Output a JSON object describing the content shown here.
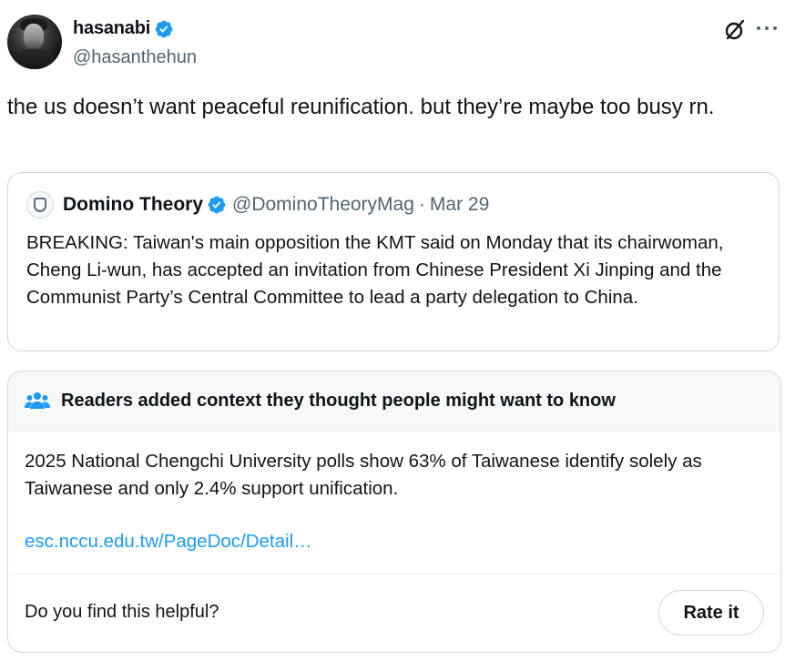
{
  "tweet": {
    "author": {
      "display_name": "hasanabi",
      "handle": "@hasanthehun",
      "verified": true
    },
    "text": "the us doesn’t want peaceful reunification. but they’re maybe too busy rn."
  },
  "quote": {
    "author": {
      "display_name": "Domino Theory",
      "handle": "@DominoTheoryMag",
      "verified": true
    },
    "separator": "·",
    "date": "Mar 29",
    "text": "BREAKING: Taiwan's main opposition the KMT said on Monday that its chairwoman, Cheng Li-wun, has accepted an invitation from Chinese President Xi Jinping and the Communist Party’s Central Committee to lead a party delegation to China."
  },
  "community_note": {
    "title": "Readers added context they thought people might want to know",
    "text": "2025 National Chengchi University polls show 63% of Taiwanese identify solely as Taiwanese and only 2.4% support unification.",
    "link_text": "esc.nccu.edu.tw/PageDoc/Detail…",
    "helpful_question": "Do you find this helpful?",
    "rate_button": "Rate it"
  },
  "icons": {
    "verified": "verified-badge-icon",
    "grok": "grok-icon",
    "more": "more-icon",
    "people": "people-icon"
  },
  "colors": {
    "verified_blue": "#1d9bf0",
    "link_blue": "#1d9bf0",
    "secondary_text": "#536471",
    "border": "#cfd9de"
  }
}
